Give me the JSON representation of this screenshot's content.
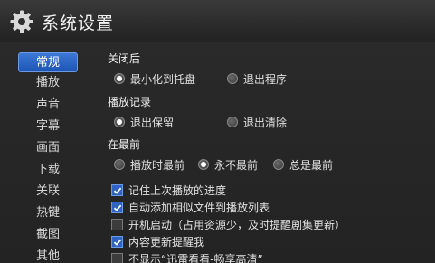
{
  "window": {
    "title": "系统设置",
    "icon": "gear-icon"
  },
  "sidebar": {
    "items": [
      {
        "label": "常规",
        "active": true
      },
      {
        "label": "播放"
      },
      {
        "label": "声音"
      },
      {
        "label": "字幕"
      },
      {
        "label": "画面"
      },
      {
        "label": "下载"
      },
      {
        "label": "关联"
      },
      {
        "label": "热键"
      },
      {
        "label": "截图"
      },
      {
        "label": "其他"
      }
    ]
  },
  "content": {
    "close": {
      "title": "关闭后",
      "options": [
        {
          "label": "最小化到托盘",
          "selected": true
        },
        {
          "label": "退出程序",
          "selected": false
        }
      ]
    },
    "history": {
      "title": "播放记录",
      "options": [
        {
          "label": "退出保留",
          "selected": true
        },
        {
          "label": "退出清除",
          "selected": false
        }
      ]
    },
    "ontop": {
      "title": "在最前",
      "options": [
        {
          "label": "播放时最前",
          "selected": false
        },
        {
          "label": "永不最前",
          "selected": true
        },
        {
          "label": "总是最前",
          "selected": false
        }
      ]
    },
    "checks": [
      {
        "label": "记住上次播放的进度",
        "checked": true
      },
      {
        "label": "自动添加相似文件到播放列表",
        "checked": true
      },
      {
        "label": "开机启动（占用资源少，及时提醒剧集更新）",
        "checked": false
      },
      {
        "label": "内容更新提醒我",
        "checked": true
      },
      {
        "label": "不显示“迅雷看看-畅享高清”",
        "checked": false
      }
    ]
  },
  "colors": {
    "accent": "#2f64c4",
    "background": "#262626"
  }
}
